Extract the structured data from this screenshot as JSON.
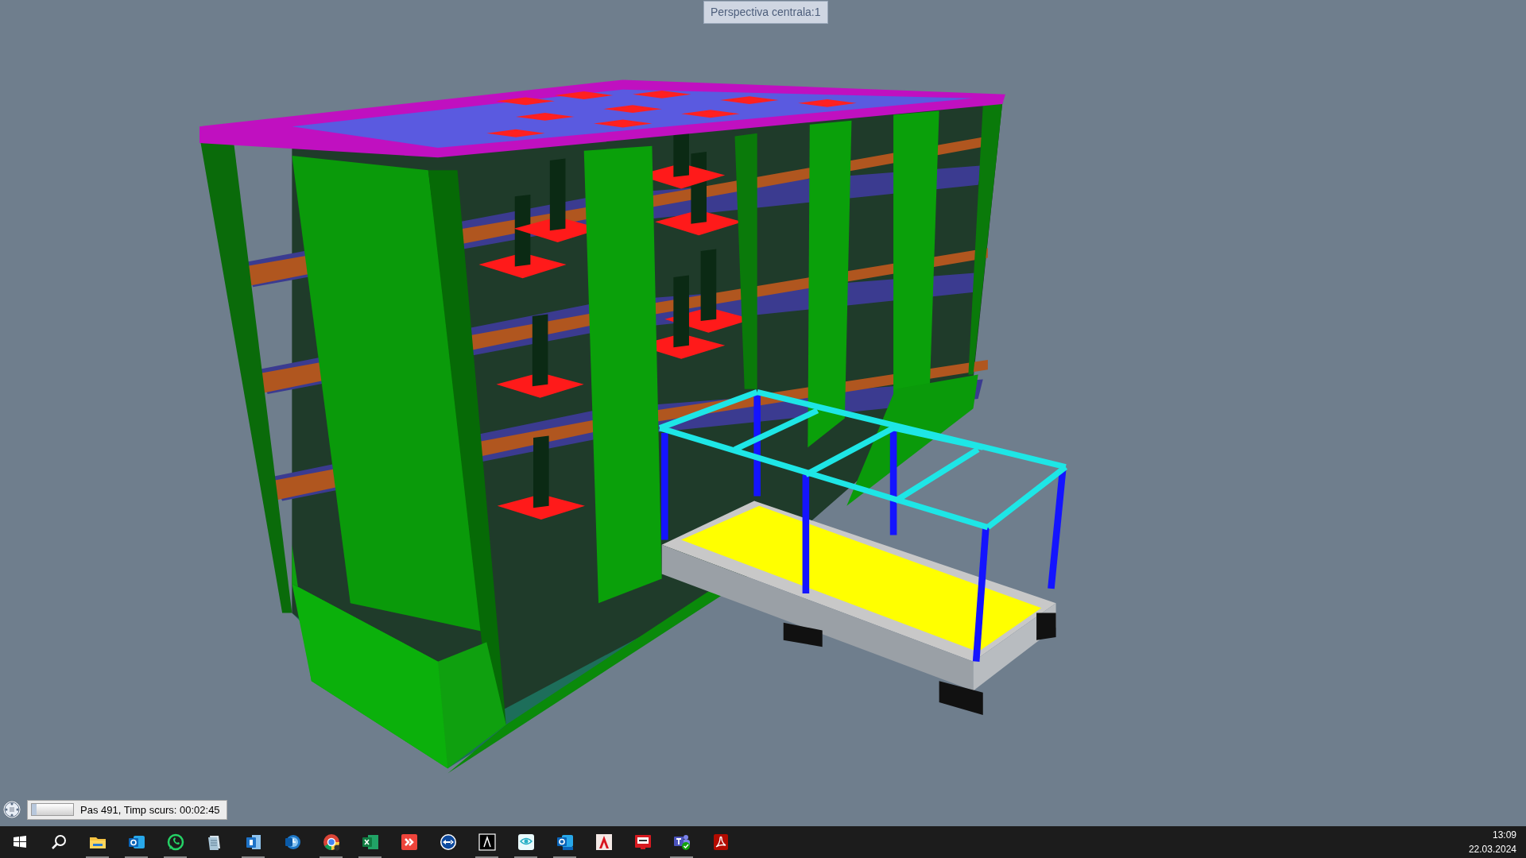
{
  "view_label": "Perspectiva centrala:1",
  "status": {
    "level": 0.12,
    "text": "Pas 491, Timp scurs: 00:02:45"
  },
  "taskbar": {
    "apps": [
      {
        "kind": "start",
        "running": false
      },
      {
        "kind": "search",
        "running": false
      },
      {
        "kind": "folder",
        "running": true
      },
      {
        "kind": "mail",
        "running": true
      },
      {
        "kind": "chat",
        "running": true
      },
      {
        "kind": "notepad",
        "running": false
      },
      {
        "kind": "document",
        "running": true
      },
      {
        "kind": "clock",
        "running": false
      },
      {
        "kind": "browser",
        "running": true
      },
      {
        "kind": "spreadsheet",
        "running": true
      },
      {
        "kind": "remote",
        "running": false
      },
      {
        "kind": "arrows",
        "running": false
      },
      {
        "kind": "lambda",
        "running": true
      },
      {
        "kind": "eye",
        "running": true
      },
      {
        "kind": "mail-new",
        "running": true
      },
      {
        "kind": "cad",
        "running": false
      },
      {
        "kind": "monitor",
        "running": false
      },
      {
        "kind": "team",
        "running": true
      },
      {
        "kind": "pdf",
        "running": false
      }
    ],
    "time": "13:09",
    "date": "22.03.2024"
  }
}
